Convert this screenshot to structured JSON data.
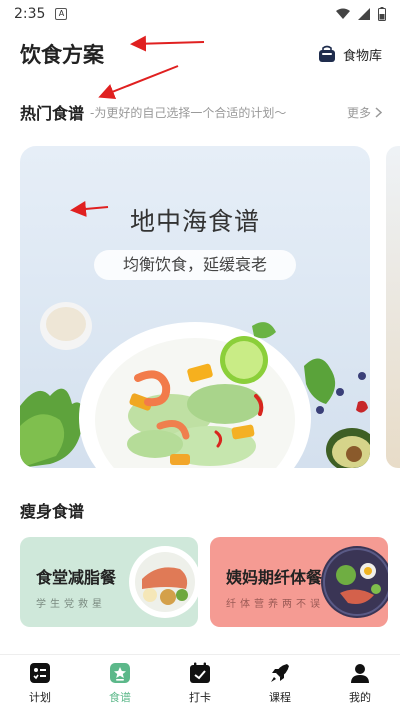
{
  "status_bar": {
    "time": "2:35",
    "notif": "A"
  },
  "header": {
    "title": "饮食方案",
    "food_library": "食物库"
  },
  "hot_section": {
    "title": "热门食谱",
    "subtitle": "-为更好的自己选择一个合适的计划～",
    "more": "更多"
  },
  "banner": {
    "title": "地中海食谱",
    "tagline": "均衡饮食，延缓衰老"
  },
  "slim_section": {
    "title": "瘦身食谱"
  },
  "cards": [
    {
      "title": "食堂减脂餐",
      "subtitle": "学生党救星"
    },
    {
      "title": "姨妈期纤体餐",
      "subtitle": "纤体营养两不误"
    }
  ],
  "tabs": [
    {
      "label": "计划",
      "icon": "plan-icon"
    },
    {
      "label": "食谱",
      "icon": "recipe-icon",
      "active": true
    },
    {
      "label": "打卡",
      "icon": "checkin-icon"
    },
    {
      "label": "课程",
      "icon": "rocket-icon"
    },
    {
      "label": "我的",
      "icon": "profile-icon"
    }
  ],
  "colors": {
    "accent": "#5cb88a",
    "card_green": "#cfe8da",
    "card_pink": "#f59b93",
    "annotation_red": "#e02020"
  }
}
